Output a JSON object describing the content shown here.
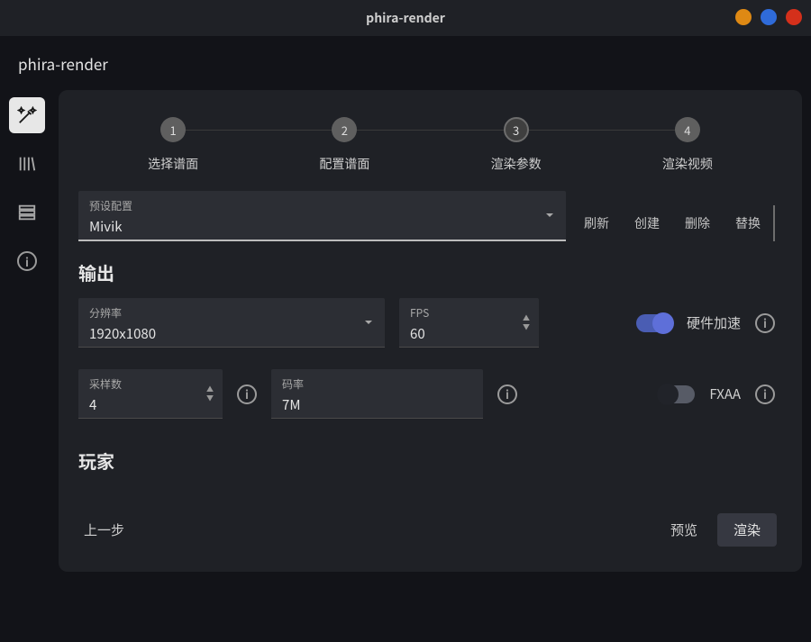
{
  "window": {
    "title": "phira-render"
  },
  "header": {
    "title": "phira-render"
  },
  "sidebar": {
    "items": [
      {
        "id": "wand",
        "active": true
      },
      {
        "id": "library",
        "active": false
      },
      {
        "id": "list",
        "active": false
      },
      {
        "id": "info",
        "active": false
      }
    ]
  },
  "stepper": {
    "active_index": 2,
    "steps": [
      {
        "num": "1",
        "label": "选择谱面"
      },
      {
        "num": "2",
        "label": "配置谱面"
      },
      {
        "num": "3",
        "label": "渲染参数"
      },
      {
        "num": "4",
        "label": "渲染视频"
      }
    ]
  },
  "preset": {
    "label": "预设配置",
    "value": "Mivik",
    "actions": {
      "refresh": "刷新",
      "create": "创建",
      "delete": "删除",
      "replace": "替换"
    }
  },
  "sections": {
    "output": {
      "title": "输出",
      "resolution": {
        "label": "分辨率",
        "value": "1920x1080"
      },
      "fps": {
        "label": "FPS",
        "value": "60"
      },
      "hwaccel": {
        "label": "硬件加速",
        "on": true
      },
      "samples": {
        "label": "采样数",
        "value": "4"
      },
      "bitrate": {
        "label": "码率",
        "value": "7M"
      },
      "fxaa": {
        "label": "FXAA",
        "on": false
      }
    },
    "player": {
      "title": "玩家"
    }
  },
  "footer": {
    "prev": "上一步",
    "preview": "预览",
    "render": "渲染"
  }
}
